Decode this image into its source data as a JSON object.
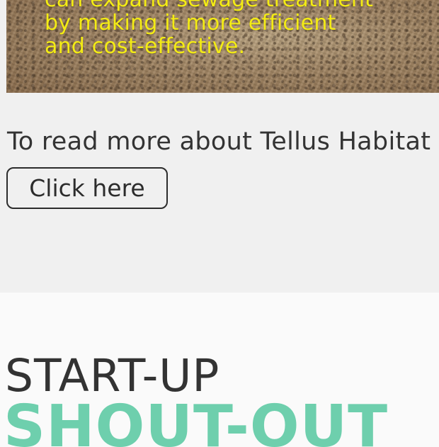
{
  "hero": {
    "caption_lines": [
      "can expand sewage treatment",
      "by making it more efficient",
      "and cost-effective."
    ],
    "caption_color": "#f4ec14"
  },
  "cta": {
    "text": "To read more about Tellus Habitat",
    "button_label": "Click here"
  },
  "shoutout": {
    "label": "START-UP",
    "title": "SHOUT-OUT",
    "title_color": "#6ecfad"
  }
}
